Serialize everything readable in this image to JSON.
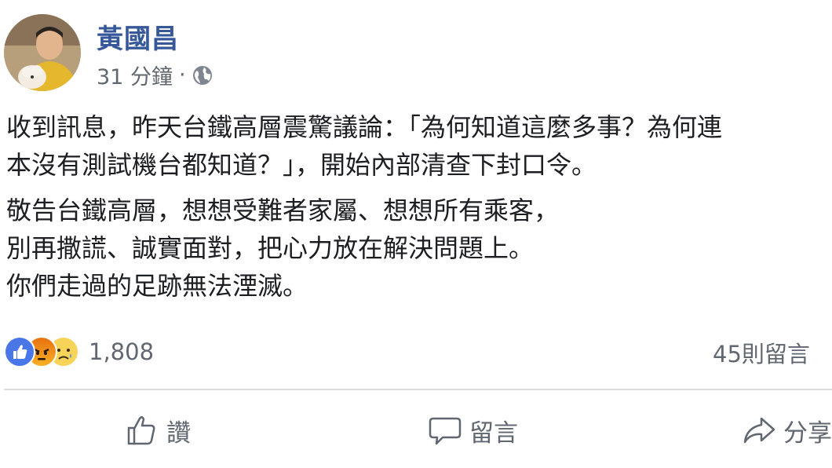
{
  "post": {
    "author": "黃國昌",
    "timestamp": "31 分鐘",
    "separator": "·",
    "privacy_icon": "globe-icon",
    "paragraphs": [
      [
        "收到訊息，昨天台鐵高層震驚議論：「為何知道這麼多事？為何連",
        "本沒有測試機台都知道？」，開始內部清查下封口令。"
      ],
      [
        "敬告台鐵高層，想想受難者家屬、想想所有乘客，",
        "別再撒謊、誠實面對，把心力放在解決問題上。",
        "你們走過的足跡無法湮滅。"
      ]
    ],
    "reactions": {
      "icons": [
        "like-icon",
        "angry-icon",
        "sad-icon"
      ],
      "count": "1,808"
    },
    "comments_count": "45則留言",
    "actions": {
      "like": "讚",
      "comment": "留言",
      "share": "分享"
    }
  },
  "colors": {
    "author": "#365899",
    "meta": "#616770",
    "text": "#1c1e21",
    "like_blue": "#4a77e8",
    "divider": "#dadde1"
  }
}
